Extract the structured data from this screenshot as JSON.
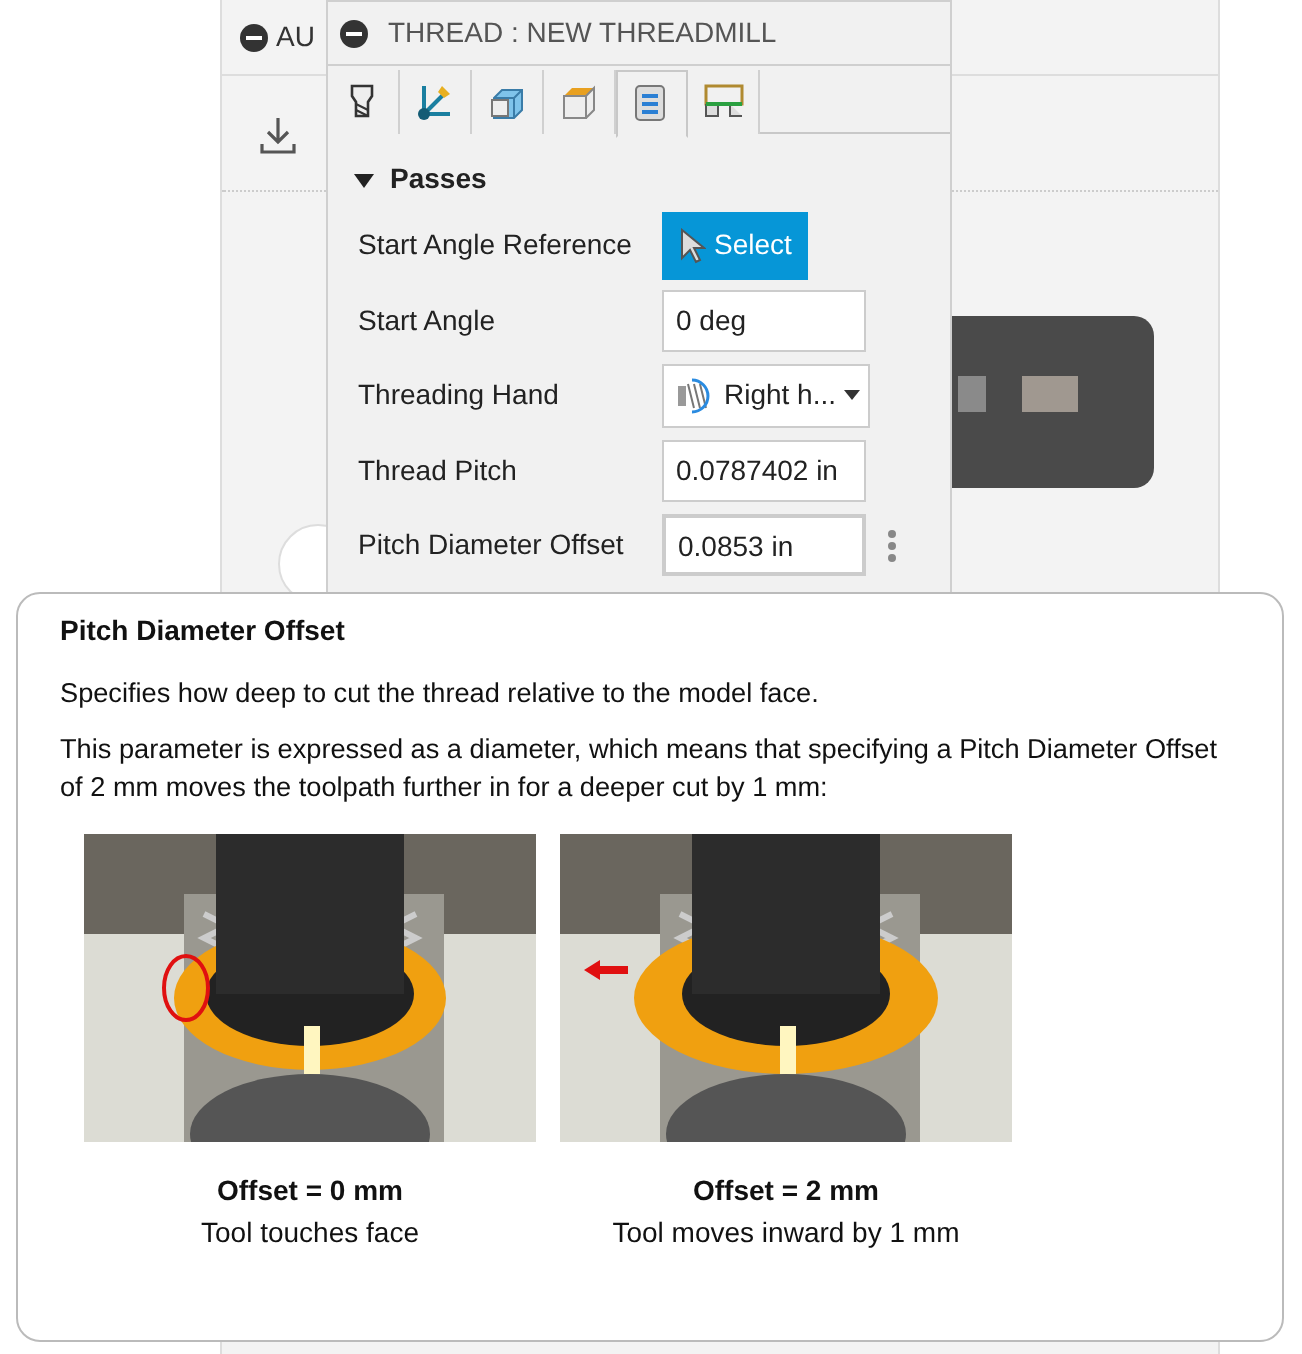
{
  "background": {
    "header_text": "AU"
  },
  "dialog": {
    "title": "THREAD : NEW THREADMILL",
    "tabs": [
      {
        "kind": "tool",
        "selected": false
      },
      {
        "kind": "geometry",
        "selected": false
      },
      {
        "kind": "stock",
        "selected": false
      },
      {
        "kind": "heights",
        "selected": false
      },
      {
        "kind": "passes",
        "selected": true
      },
      {
        "kind": "linking",
        "selected": false
      }
    ],
    "section": {
      "title": "Passes",
      "expanded": true
    },
    "fields": [
      {
        "kind": "button",
        "label": "Start Angle Reference",
        "value": "Select",
        "has_menu": false
      },
      {
        "kind": "input",
        "label": "Start Angle",
        "value": "0 deg",
        "has_menu": false
      },
      {
        "kind": "dropdown",
        "label": "Threading Hand",
        "value": "Right h...",
        "has_menu": false
      },
      {
        "kind": "input",
        "label": "Thread Pitch",
        "value": "0.0787402 in",
        "has_menu": false
      },
      {
        "kind": "input",
        "label": "Pitch Diameter Offset",
        "value": "0.0853 in",
        "has_menu": true
      }
    ]
  },
  "tooltip": {
    "title": "Pitch Diameter Offset",
    "paragraphs": [
      "Specifies how deep to cut the thread relative to the model face.",
      "This parameter is expressed as a diameter, which means that specifying a Pitch Diameter Offset of 2 mm moves the toolpath further in for a deeper cut by 1 mm:"
    ],
    "figures": [
      {
        "kind": "picture",
        "caption_title": "Offset = 0 mm",
        "caption": "Tool touches face"
      },
      {
        "kind": "picture",
        "caption_title": "Offset = 2 mm",
        "caption": "Tool moves inward by 1 mm"
      }
    ]
  }
}
